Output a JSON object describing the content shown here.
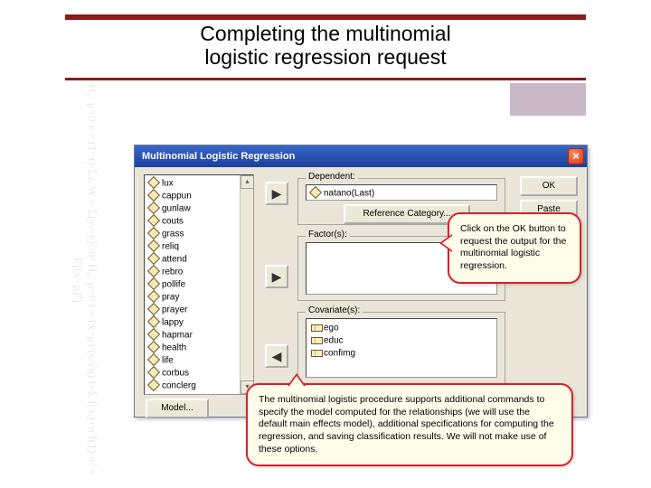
{
  "slide": {
    "title_line1": "Completing the multinomial",
    "title_line2": "logistic regression request"
  },
  "dialog": {
    "title": "Multinomial Logistic Regression",
    "source_vars": [
      "lux",
      "cappun",
      "gunlaw",
      "couts",
      "grass",
      "reliq",
      "attend",
      "rebro",
      "pollife",
      "pray",
      "prayer",
      "lappy",
      "hapmar",
      "health",
      "life",
      "corbus",
      "conclerg"
    ],
    "labels": {
      "dependent": "Dependent:",
      "factors": "Factor(s):",
      "covariates": "Covariate(s):",
      "ref_cat_btn": "Reference Category...",
      "model_btn": "Model...",
      "ok": "OK",
      "paste": "Paste"
    },
    "dependent_value": "natano(Last)",
    "covariates": [
      "ego",
      "educ",
      "confimg"
    ]
  },
  "callouts": {
    "c1": "Click on the OK button to request the output for the multinomial logistic regression.",
    "c2": "The multinomial logistic procedure supports additional commands to specify the model computed for the relationships (we will use the default main effects model),  additional specifications for computing the regression, and saving classification results. We will not make use of these options."
  },
  "bgtext": "H₁: μ<0   s = (1−t)·Σzᵢ   W = Σ(yᵢ−ŷ)²/σ²   H₀: μ=0   t = (x̄−μ)/(s/√n)   l=Σ f(xᵢ)+α f(1)   σ² = E[(x−μ)²]"
}
